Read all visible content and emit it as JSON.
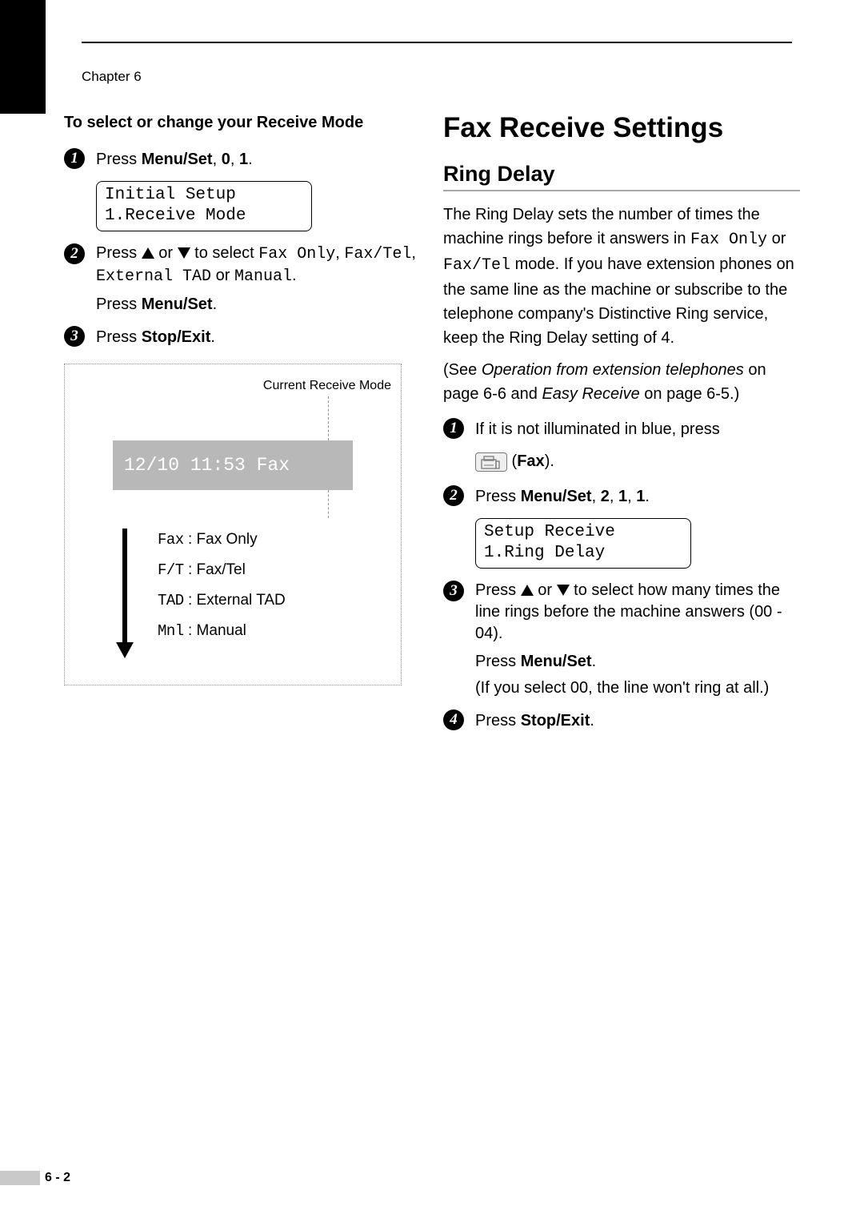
{
  "chapter": "Chapter 6",
  "left": {
    "heading": "To select or change your Receive Mode",
    "step1_pre": "Press ",
    "step1_menu": "Menu/Set",
    "step1_post": ", ",
    "step1_k1": "0",
    "step1_sep": ", ",
    "step1_k2": "1",
    "step1_dot": ".",
    "lcd_line1": "Initial Setup",
    "lcd_line2": "1.Receive Mode",
    "step2_pre": "Press ",
    "step2_or": " or ",
    "step2_mid": " to select ",
    "step2_opt1": "Fax Only",
    "step2_c1": ", ",
    "step2_opt2": "Fax/Tel",
    "step2_c2": ", ",
    "step2_opt3": "External TAD",
    "step2_or2": " or ",
    "step2_opt4": "Manual",
    "step2_dot": ".",
    "step2_line2_pre": "Press ",
    "step2_line2_b": "Menu/Set",
    "step2_line2_dot": ".",
    "step3_pre": "Press ",
    "step3_b": "Stop/Exit",
    "step3_dot": ".",
    "diagram_label": "Current Receive Mode",
    "display_text": "12/10 11:53  Fax",
    "modes": [
      {
        "code": "Fax",
        "label": " : Fax Only"
      },
      {
        "code": "F/T",
        "label": " : Fax/Tel"
      },
      {
        "code": "TAD",
        "label": " : External TAD"
      },
      {
        "code": "Mnl",
        "label": " : Manual"
      }
    ]
  },
  "right": {
    "h1": "Fax Receive Settings",
    "h2": "Ring Delay",
    "p1_a": "The Ring Delay sets the number of times the machine rings before it answers in ",
    "p1_m1": "Fax Only",
    "p1_b": " or ",
    "p1_m2": "Fax/Tel",
    "p1_c": " mode. If you have extension phones on the same line as the machine or subscribe to the telephone company's Distinctive Ring service, keep the Ring Delay setting of 4.",
    "p2_a": "(See ",
    "p2_i1": "Operation from extension telephones",
    "p2_b": " on page 6-6 and ",
    "p2_i2": "Easy Receive",
    "p2_c": " on page 6-5.)",
    "step1_text": "If it is not illuminated in blue, press",
    "fax_label_pre": " (",
    "fax_label": "Fax",
    "fax_label_post": ").",
    "step2_pre": "Press ",
    "step2_b": "Menu/Set",
    "step2_post": ", ",
    "step2_k1": "2",
    "step2_s1": ", ",
    "step2_k2": "1",
    "step2_s2": ", ",
    "step2_k3": "1",
    "step2_dot": ".",
    "lcd_line1": "Setup Receive",
    "lcd_line2": "1.Ring Delay",
    "step3_pre": "Press ",
    "step3_or": " or ",
    "step3_mid": " to select how many times the line rings before the machine answers (00 - 04).",
    "step3_l2_pre": "Press ",
    "step3_l2_b": "Menu/Set",
    "step3_l2_dot": ".",
    "step3_l3": "(If you select 00, the line won't ring at all.)",
    "step4_pre": "Press ",
    "step4_b": "Stop/Exit",
    "step4_dot": "."
  },
  "footer": "6 - 2"
}
